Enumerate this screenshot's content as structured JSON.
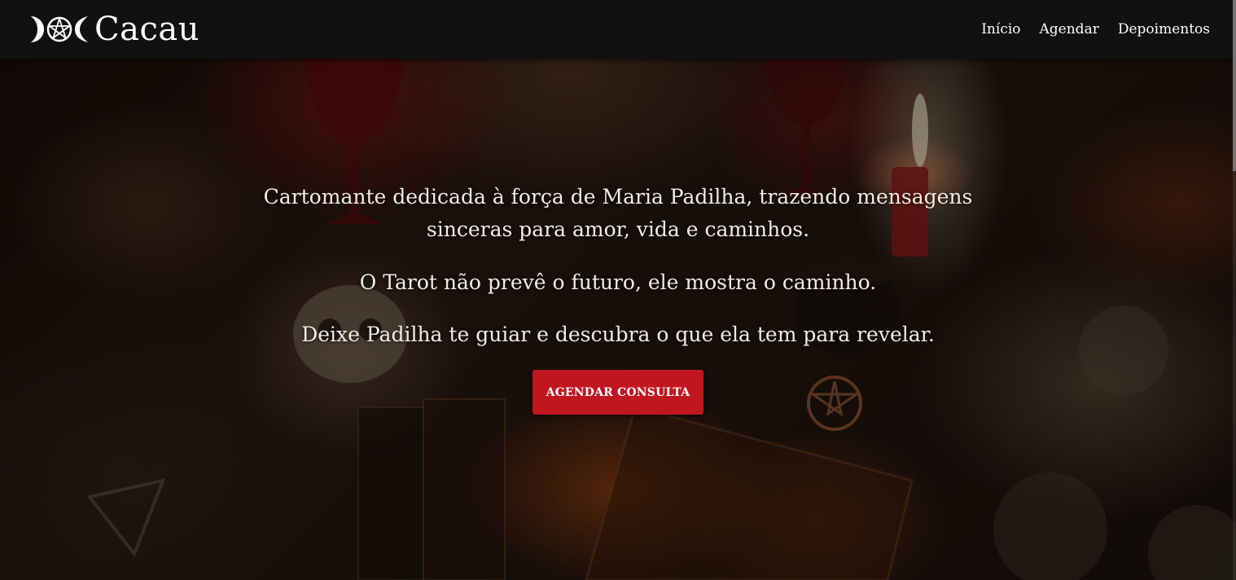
{
  "brand": {
    "name": "Cacau",
    "logo_icon": "triple-moon-pentagram-icon"
  },
  "nav": {
    "items": [
      {
        "label": "Início"
      },
      {
        "label": "Agendar"
      },
      {
        "label": "Depoimentos"
      }
    ]
  },
  "hero": {
    "lines": [
      "Cartomante dedicada à força de Maria Padilha, trazendo mensagens sinceras para amor, vida e caminhos.",
      "O Tarot não prevê o futuro, ele mostra o caminho.",
      "Deixe Padilha te guiar e descubra o que ela tem para revelar."
    ],
    "cta_label": "AGENDAR CONSULTA"
  },
  "colors": {
    "navbar": "#111111",
    "cta": "#c0161f",
    "text": "#ffffff"
  }
}
